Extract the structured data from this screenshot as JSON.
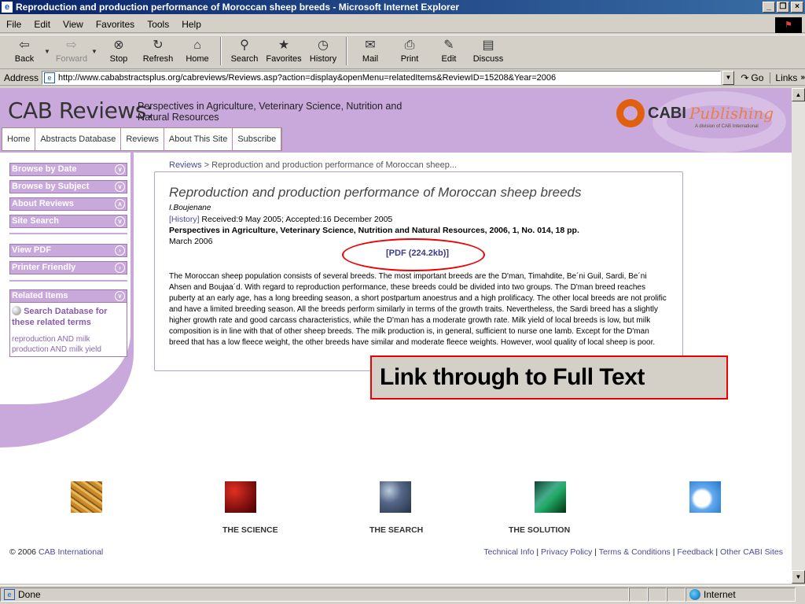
{
  "window": {
    "title": "Reproduction and production performance of Moroccan sheep breeds - Microsoft Internet Explorer",
    "min": "_",
    "max": "❐",
    "close": "×"
  },
  "menu": [
    "File",
    "Edit",
    "View",
    "Favorites",
    "Tools",
    "Help"
  ],
  "toolbar": {
    "back": "Back",
    "forward": "Forward",
    "stop": "Stop",
    "refresh": "Refresh",
    "home": "Home",
    "search": "Search",
    "favorites": "Favorites",
    "history": "History",
    "mail": "Mail",
    "print": "Print",
    "edit": "Edit",
    "discuss": "Discuss"
  },
  "address": {
    "label": "Address",
    "url": "http://www.cababstractsplus.org/cabreviews/Reviews.asp?action=display&openMenu=relatedItems&ReviewID=15208&Year=2006",
    "go": "Go",
    "links": "Links"
  },
  "header": {
    "title": "CAB Reviews:",
    "subtitle": "Perspectives in Agriculture, Veterinary Science, Nutrition and Natural Resources",
    "brand": "CABI",
    "brand_pub": "Publishing",
    "brand_sub": "A division of CAB International"
  },
  "nav": [
    "Home",
    "Abstracts Database",
    "Reviews",
    "About This Site",
    "Subscribe"
  ],
  "sidebar": {
    "items": [
      "Browse by Date",
      "Browse by Subject",
      "About Reviews",
      "Site Search"
    ],
    "tools": [
      "View PDF",
      "Printer Friendly"
    ],
    "related": {
      "title": "Related Items",
      "search": "Search Database for these related terms",
      "terms": "reproduction AND milk production AND milk yield"
    }
  },
  "breadcrumb": {
    "link": "Reviews",
    "sep": " > ",
    "current": "Reproduction and production performance of Moroccan sheep..."
  },
  "article": {
    "title": "Reproduction and production performance of Moroccan sheep breeds",
    "author": "I.Boujenane",
    "history_link": "[History]",
    "history": " Received:9 May 2005; Accepted:16 December 2005",
    "journal": "Perspectives in Agriculture, Veterinary Science, Nutrition and Natural Resources, 2006, 1, No. 014, 18 pp.",
    "date": "March 2006",
    "pdf": "[PDF (224.2kb)]",
    "abstract": "The Moroccan sheep population consists of several breeds. The most important breeds are the D'man, Timahdite, Be´ni Guil, Sardi, Be´ni Ahsen and Boujaa´d. With regard to reproduction performance, these breeds could be divided into two groups. The D'man breed reaches puberty at an early age, has a long breeding season, a short postpartum anoestrus and a high prolificacy. The other local breeds are not prolific and have a limited breeding season. All the breeds perform similarly in terms of the growth traits. Nevertheless, the Sardi breed has a slightly higher growth rate and good carcass characteristics, while the D'man has a moderate growth rate. Milk yield of local breeds is low, but milk composition is in line with that of other sheep breeds. The milk production is, in general, sufficient to nurse one lamb. Except for the D'man breed that has a low fleece weight, the other breeds have similar and moderate fleece weights. However, wool quality of local sheep is poor."
  },
  "callout": "Link through to Full Text",
  "footer": {
    "labels": [
      "THE SCIENCE",
      "THE SEARCH",
      "THE SOLUTION"
    ],
    "copyright_prefix": "© 2006 ",
    "copyright_link": "CAB International",
    "links": [
      "Technical Info",
      "Privacy Policy",
      "Terms & Conditions",
      "Feedback",
      "Other CABI Sites"
    ]
  },
  "status": {
    "text": "Done",
    "zone": "Internet"
  }
}
